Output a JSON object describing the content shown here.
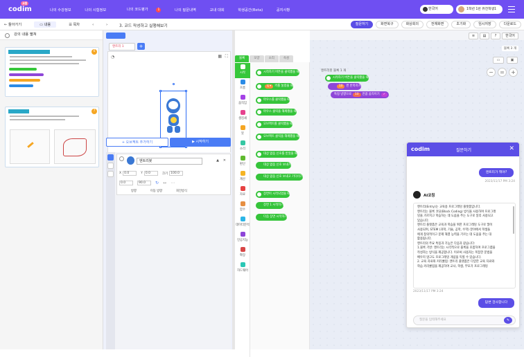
{
  "header": {
    "logo": "codim",
    "logo_sup": "교원",
    "nav": [
      "나의 수강정보",
      "나의 시험정보",
      "나의 코드평가",
      "나의 질문내역",
      "교내 대회",
      "학생공간(Beta)",
      "공지사항"
    ],
    "nav_badge": "1",
    "language": "한국어",
    "user": "1학년 1반 유전학생1"
  },
  "toolbar": {
    "back": "돌아가기",
    "content_tab": "내용",
    "toc_tab": "목차",
    "title": "3. 코드 작성하고 실행해보기",
    "buttons": [
      "질문하기",
      "화면복구",
      "화상회의",
      "전체화면",
      "초기화",
      "임시저장",
      "다운로드"
    ]
  },
  "left": {
    "header": "강의 내용 펼쳐",
    "card1_num": "6",
    "card2_num": "7"
  },
  "stage": {
    "tab_name": "엔트리 1",
    "add_object": "+ 오브젝트 추가하기",
    "run": "▶ 시작하기",
    "object_name": "엔트리봇",
    "x_label": "X",
    "x_val": "0.0",
    "y_label": "Y",
    "y_val": "0.0",
    "size_label": "크기",
    "size_val": "100.0",
    "dir_label": "방향",
    "dir_val": "0.0",
    "movedir_label": "이동 방향",
    "movedir_val": "90.0",
    "rotate_label": "회전방식",
    "labels3": [
      "방향",
      "이동 방향",
      "회전방식"
    ]
  },
  "blocks": {
    "tabs": [
      "블록",
      "모양",
      "소리",
      "속성"
    ],
    "categories": [
      "시작",
      "흐름",
      "움직임",
      "생김새",
      "붓",
      "소리",
      "판단",
      "계산",
      "자료",
      "함수",
      "데이터분석",
      "인공지능",
      "확장",
      "하드웨어"
    ],
    "palette": [
      "시작하기 버튼을 클릭했을 때",
      "키를 눌렀을 때",
      "마우스를 클릭했을 때",
      "마우스 클릭을 해제했을 때",
      "오브젝트를 클릭했을 때",
      "오브젝트 클릭을 해제했을 때",
      "대상 없음 신호를 받았을 때",
      "대상 없음 신호 보내기",
      "대상 없음 신호 보내고 기다리기",
      "장면이 시작되었을 때",
      "장면 1 시작하기",
      "다음 장면 시작하기"
    ]
  },
  "workspace": {
    "tag": "엔트리봇",
    "tag2": "블록 1 개",
    "block1": "시작하기 버튼을 클릭했을 때",
    "block2_chip": "10",
    "block2": "번 반복하기",
    "block3_pre": "특정 방향으로",
    "block3_chip": "10",
    "block3": "만큼 움직이기",
    "block_count": "블록 3 개",
    "zoom_minus": "−",
    "zoom_reset": "=",
    "zoom_plus": "+",
    "help": "도움말"
  },
  "chat": {
    "logo": "codim",
    "title": "질문하기",
    "user_msg": "엔트리가 뭐야?",
    "user_time": "2023/11/17 PM 3:24",
    "ai_name": "AI코칭",
    "ai_lines": [
      "엔트리(Entry)는 교육용 프로그래밍 플랫폼입니다.",
      "엔트리는 블록 코딩(Block Coding) 방식을 사용하여 프로그래",
      "밍을 가르치고 학습하는 데 도움을 주는 도구로 널리 사용되고",
      "있습니다.",
      "엔트리 플랫폼은 교육과 학습을 위한 프로그래밍 도구로 많이",
      "사용되며, STEM (과학, 기술, 공학, 수학) 분야에서 학생들",
      "에게 창의적이고 문제 해결 능력을 기르는 데 도움을 주는 대",
      "활용됩니다.",
      "엔트리의 주요 특징과 기능은 다음과 같습니다:",
      "1.블록 기반: 엔트리는 시각적으로 블록을 조합하여 프로그램을",
      "작성하는 방식을 제공합니다. 이로써 사용자는 복잡한 문법을",
      "배우지 않고도 프로그래밍 개념을 익힐 수 있습니다.",
      "2. 교육 자료와 커리큘럼: 엔트리 플랫폼은 다양한 교육 자료와",
      "학습 커리큘럼을 제공하여 교사, 학생, 부모가 프로그래밍"
    ],
    "ai_time": "2023/11/17 PM 3:24",
    "continue_btn": "답변 검사합니다",
    "input_placeholder": "질문을 입력해주세요"
  }
}
